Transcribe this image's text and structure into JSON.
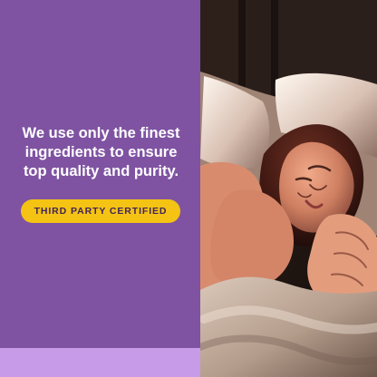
{
  "headline": "We use only the finest ingredients to ensure top quality and purity.",
  "badge": {
    "label": "THIRD PARTY CERTIFIED"
  },
  "colors": {
    "panel": "#7f53a2",
    "strip": "#c79be8",
    "badge": "#f5c313",
    "badge_text": "#3f245a"
  },
  "photo": {
    "subject": "woman-sleeping-on-pillow"
  }
}
